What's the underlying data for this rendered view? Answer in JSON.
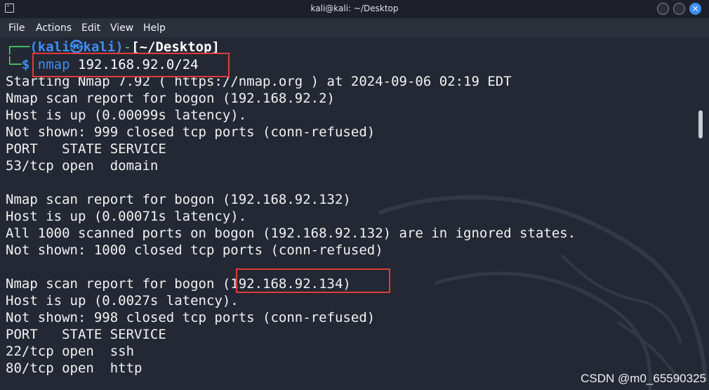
{
  "window": {
    "title": "kali@kali: ~/Desktop",
    "close_symbol": "×"
  },
  "menu": [
    "File",
    "Actions",
    "Edit",
    "View",
    "Help"
  ],
  "prompt": {
    "corner": "┌──",
    "user_host": "(kali㉿kali)",
    "dash": "-",
    "cwd": "[~/Desktop]",
    "prefix": "└─",
    "dollar": "$",
    "command": "nmap",
    "argument": "192.168.92.0/24"
  },
  "output": [
    "Starting Nmap 7.92 ( https://nmap.org ) at 2024-09-06 02:19 EDT",
    "Nmap scan report for bogon (192.168.92.2)",
    "Host is up (0.00099s latency).",
    "Not shown: 999 closed tcp ports (conn-refused)",
    "PORT   STATE SERVICE",
    "53/tcp open  domain",
    "",
    "Nmap scan report for bogon (192.168.92.132)",
    "Host is up (0.00071s latency).",
    "All 1000 scanned ports on bogon (192.168.92.132) are in ignored states.",
    "Not shown: 1000 closed tcp ports (conn-refused)",
    "",
    "Nmap scan report for bogon (192.168.92.134)",
    "Host is up (0.0027s latency).",
    "Not shown: 998 closed tcp ports (conn-refused)",
    "PORT   STATE SERVICE",
    "22/tcp open  ssh",
    "80/tcp open  http"
  ],
  "watermark_text": "CSDN @m0_65590325",
  "colors": {
    "background": "#232834",
    "prompt_blue": "#3d8ef5",
    "prompt_green": "#4fe06b",
    "highlight_red": "#e03b3b"
  }
}
